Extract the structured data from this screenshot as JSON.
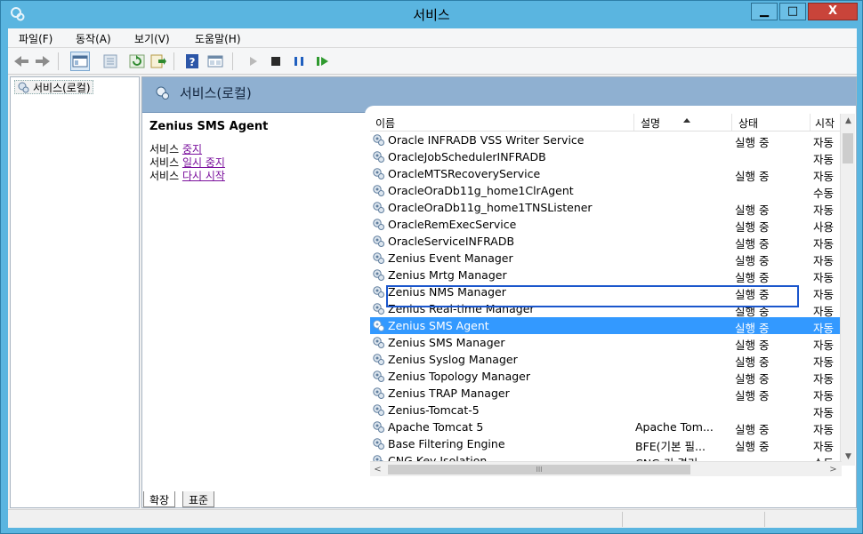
{
  "window": {
    "title": "서비스",
    "minimize_label": "▁",
    "maximize_label": "□",
    "close_label": "X"
  },
  "menu": {
    "items": [
      {
        "label": "파일(F)"
      },
      {
        "label": "동작(A)"
      },
      {
        "label": "보기(V)"
      },
      {
        "label": "도움말(H)"
      }
    ]
  },
  "toolbar": {
    "icons": [
      "back-icon",
      "forward-icon",
      "console-tree-icon",
      "properties-icon",
      "refresh-icon",
      "export-icon",
      "help-icon",
      "view-icon",
      "start-icon",
      "stop-icon",
      "pause-icon",
      "resume-icon"
    ]
  },
  "tree": {
    "root_label": "서비스(로컬)"
  },
  "pane": {
    "header_title": "서비스(로컬)"
  },
  "details": {
    "service_name": "Zenius SMS Agent",
    "prefix": "서비스",
    "links": [
      {
        "label": "중지"
      },
      {
        "label": "일시 중지"
      },
      {
        "label": "다시 시작"
      }
    ]
  },
  "list": {
    "columns": {
      "name": "이름",
      "description": "설명",
      "status": "상태",
      "startup": "시작"
    },
    "rows": [
      {
        "name": "Oracle INFRADB VSS Writer Service",
        "description": "",
        "status": "실행 중",
        "startup": "자동"
      },
      {
        "name": "OracleJobSchedulerINFRADB",
        "description": "",
        "status": "",
        "startup": "자동"
      },
      {
        "name": "OracleMTSRecoveryService",
        "description": "",
        "status": "실행 중",
        "startup": "자동"
      },
      {
        "name": "OracleOraDb11g_home1ClrAgent",
        "description": "",
        "status": "",
        "startup": "수동"
      },
      {
        "name": "OracleOraDb11g_home1TNSListener",
        "description": "",
        "status": "실행 중",
        "startup": "자동"
      },
      {
        "name": "OracleRemExecService",
        "description": "",
        "status": "실행 중",
        "startup": "사용"
      },
      {
        "name": "OracleServiceINFRADB",
        "description": "",
        "status": "실행 중",
        "startup": "자동"
      },
      {
        "name": "Zenius Event Manager",
        "description": "",
        "status": "실행 중",
        "startup": "자동"
      },
      {
        "name": "Zenius Mrtg Manager",
        "description": "",
        "status": "실행 중",
        "startup": "자동"
      },
      {
        "name": "Zenius NMS Manager",
        "description": "",
        "status": "실행 중",
        "startup": "자동"
      },
      {
        "name": "Zenius Real-time Manager",
        "description": "",
        "status": "실행 중",
        "startup": "자동"
      },
      {
        "name": "Zenius SMS Agent",
        "description": "",
        "status": "실행 중",
        "startup": "자동"
      },
      {
        "name": "Zenius SMS Manager",
        "description": "",
        "status": "실행 중",
        "startup": "자동"
      },
      {
        "name": "Zenius Syslog Manager",
        "description": "",
        "status": "실행 중",
        "startup": "자동"
      },
      {
        "name": "Zenius Topology Manager",
        "description": "",
        "status": "실행 중",
        "startup": "자동"
      },
      {
        "name": "Zenius TRAP Manager",
        "description": "",
        "status": "실행 중",
        "startup": "자동"
      },
      {
        "name": "Zenius-Tomcat-5",
        "description": "",
        "status": "",
        "startup": "자동"
      },
      {
        "name": "Apache Tomcat 5",
        "description": "Apache Tom...",
        "status": "실행 중",
        "startup": "자동"
      },
      {
        "name": "Base Filtering Engine",
        "description": "BFE(기본 필...",
        "status": "실행 중",
        "startup": "자동"
      },
      {
        "name": "CNG Key Isolation",
        "description": "CNG 키 격리 ...",
        "status": "",
        "startup": "수동"
      }
    ],
    "selected_index": 11
  },
  "tabs": {
    "extended": "확장",
    "standard": "표준"
  },
  "colors": {
    "title_bar": "#5ab5e0",
    "selection": "#3399ff",
    "pane_header": "#8fb0d1",
    "link": "#7a0f9c"
  }
}
